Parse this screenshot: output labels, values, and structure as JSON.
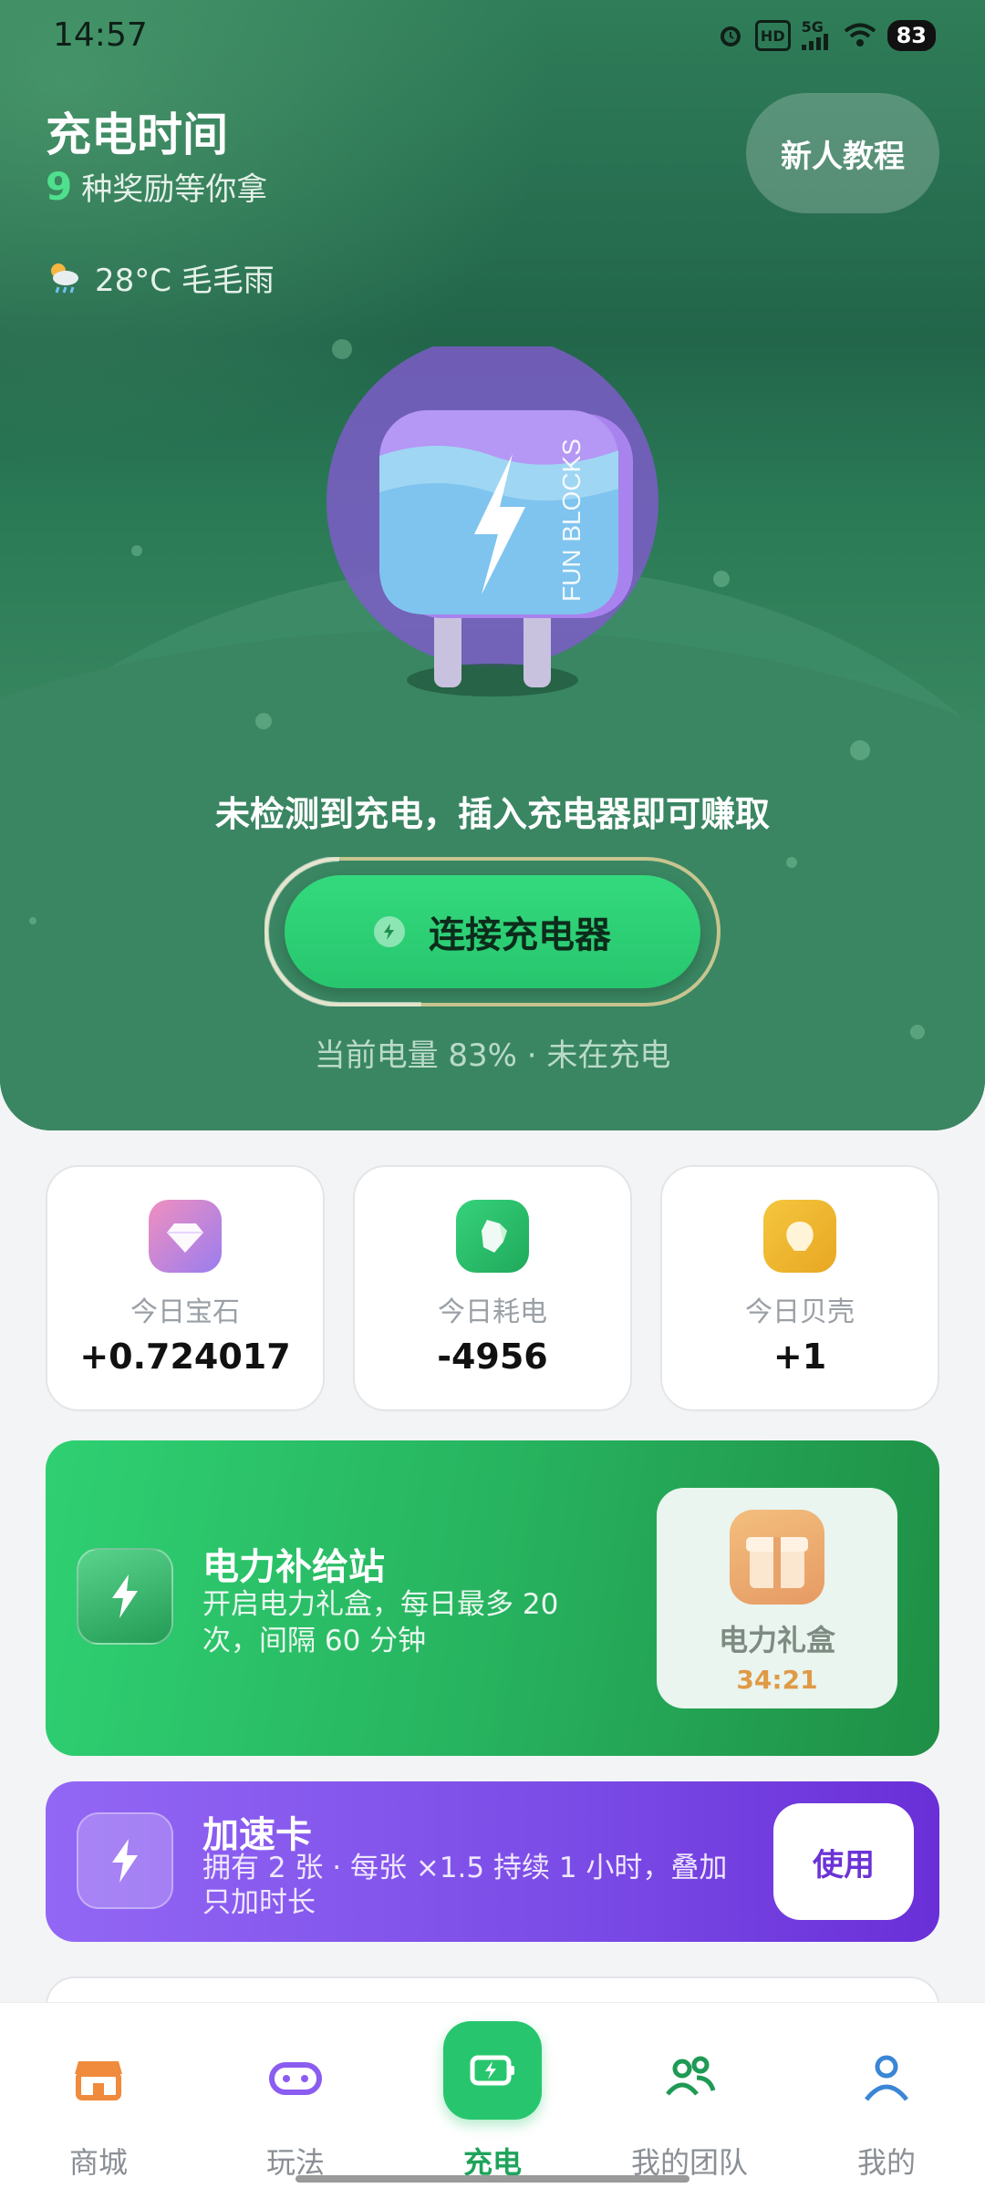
{
  "status_bar": {
    "time": "14:57",
    "network": "5G",
    "hd": "HD",
    "battery": "83"
  },
  "header": {
    "title": "充电时间",
    "reward_count": "9",
    "reward_text": "种奖励等你拿",
    "tutorial_label": "新人教程"
  },
  "weather": {
    "text": "28°C 毛毛雨",
    "icon": "cloud-sun-rain-icon"
  },
  "charger": {
    "brand_text": "FUN BLOCKS"
  },
  "charge": {
    "hint": "未检测到充电，插入充电器即可赚取",
    "button_label": "连接充电器",
    "battery_status": "当前电量 83% · 未在充电",
    "battery_level_percent": 83
  },
  "stats": [
    {
      "label": "今日宝石",
      "value": "+0.724017",
      "icon": "diamond-icon"
    },
    {
      "label": "今日耗电",
      "value": "-4956",
      "icon": "crystal-icon"
    },
    {
      "label": "今日贝壳",
      "value": "+1",
      "icon": "shell-icon"
    }
  ],
  "power_station": {
    "title": "电力补给站",
    "desc": "开启电力礼盒，每日最多 20 次，间隔 60 分钟",
    "gift_label": "电力礼盒",
    "gift_timer": "34:21"
  },
  "speed_card": {
    "title": "加速卡",
    "desc": "拥有 2 张 · 每张 ×1.5 持续 1 小时，叠加只加时长",
    "use_label": "使用"
  },
  "nav": [
    {
      "label": "商城",
      "icon": "store-icon"
    },
    {
      "label": "玩法",
      "icon": "gamepad-icon"
    },
    {
      "label": "充电",
      "icon": "battery-charge-icon",
      "active": true
    },
    {
      "label": "我的团队",
      "icon": "team-icon"
    },
    {
      "label": "我的",
      "icon": "user-icon"
    }
  ],
  "colors": {
    "accent_green": "#27c66e",
    "purple": "#7a4be6",
    "hero_green": "#2a7a56"
  }
}
